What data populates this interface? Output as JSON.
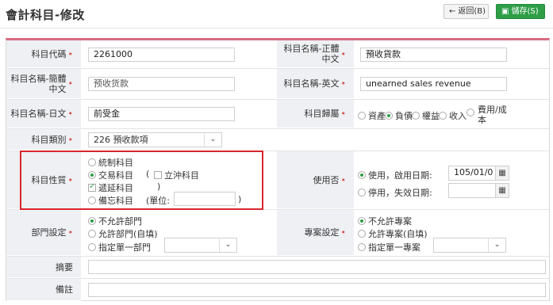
{
  "header": {
    "title": "會計科目-修改",
    "back_label": "返回(B)",
    "save_label": "儲存(S)",
    "back_icon": "arrow-left-icon",
    "save_icon": "floppy-disk-icon"
  },
  "fields": {
    "code": {
      "label": "科目代碼",
      "value": "2261000"
    },
    "name_trad": {
      "label": "科目名稱-正體中文",
      "value": "預收貨款"
    },
    "name_simp": {
      "label": "科目名稱-簡體中文",
      "value": "预收货款"
    },
    "name_en": {
      "label": "科目名稱-英文",
      "value": "unearned sales revenue"
    },
    "name_jp": {
      "label": "科目名稱-日文",
      "value": "前受金"
    },
    "belong": {
      "label": "科目歸屬",
      "options": [
        "資產",
        "負債",
        "權益",
        "收入",
        "費用/成本"
      ],
      "selected": "負債"
    },
    "category": {
      "label": "科目類別",
      "value": "226 預收款項"
    },
    "nature": {
      "label": "科目性質",
      "options": {
        "control": "統制科目",
        "trade": "交易科目",
        "offset_open": "(",
        "offset": "立沖科目",
        "offset_close": ")",
        "deferred": "遞延科目",
        "deferred_close": ")",
        "memo": "備忘科目",
        "unit_open": "(單位:",
        "unit_close": ")"
      },
      "selected": "交易科目",
      "deferred_checked": true,
      "offset_checked": false
    },
    "in_use": {
      "label": "使用否",
      "use_label": "使用，啟用日期:",
      "use_date": "105/01/0",
      "stop_label": "停用，失效日期:",
      "stop_date": "",
      "selected": "使用"
    },
    "dept": {
      "label": "部門設定",
      "options": [
        "不允許部門",
        "允許部門(自填)",
        "指定單一部門"
      ],
      "selected": "不允許部門"
    },
    "project": {
      "label": "專案設定",
      "options": [
        "不允許專案",
        "允許專案(自填)",
        "指定單一專案"
      ],
      "selected": "不允許專案"
    },
    "summary": {
      "label": "摘要",
      "value": ""
    },
    "remark": {
      "label": "備註",
      "value": ""
    }
  },
  "colors": {
    "accent": "#2e9e47",
    "required": "#d9534f",
    "highlight_box": "#d9262c",
    "form_top": "#d96a82"
  }
}
